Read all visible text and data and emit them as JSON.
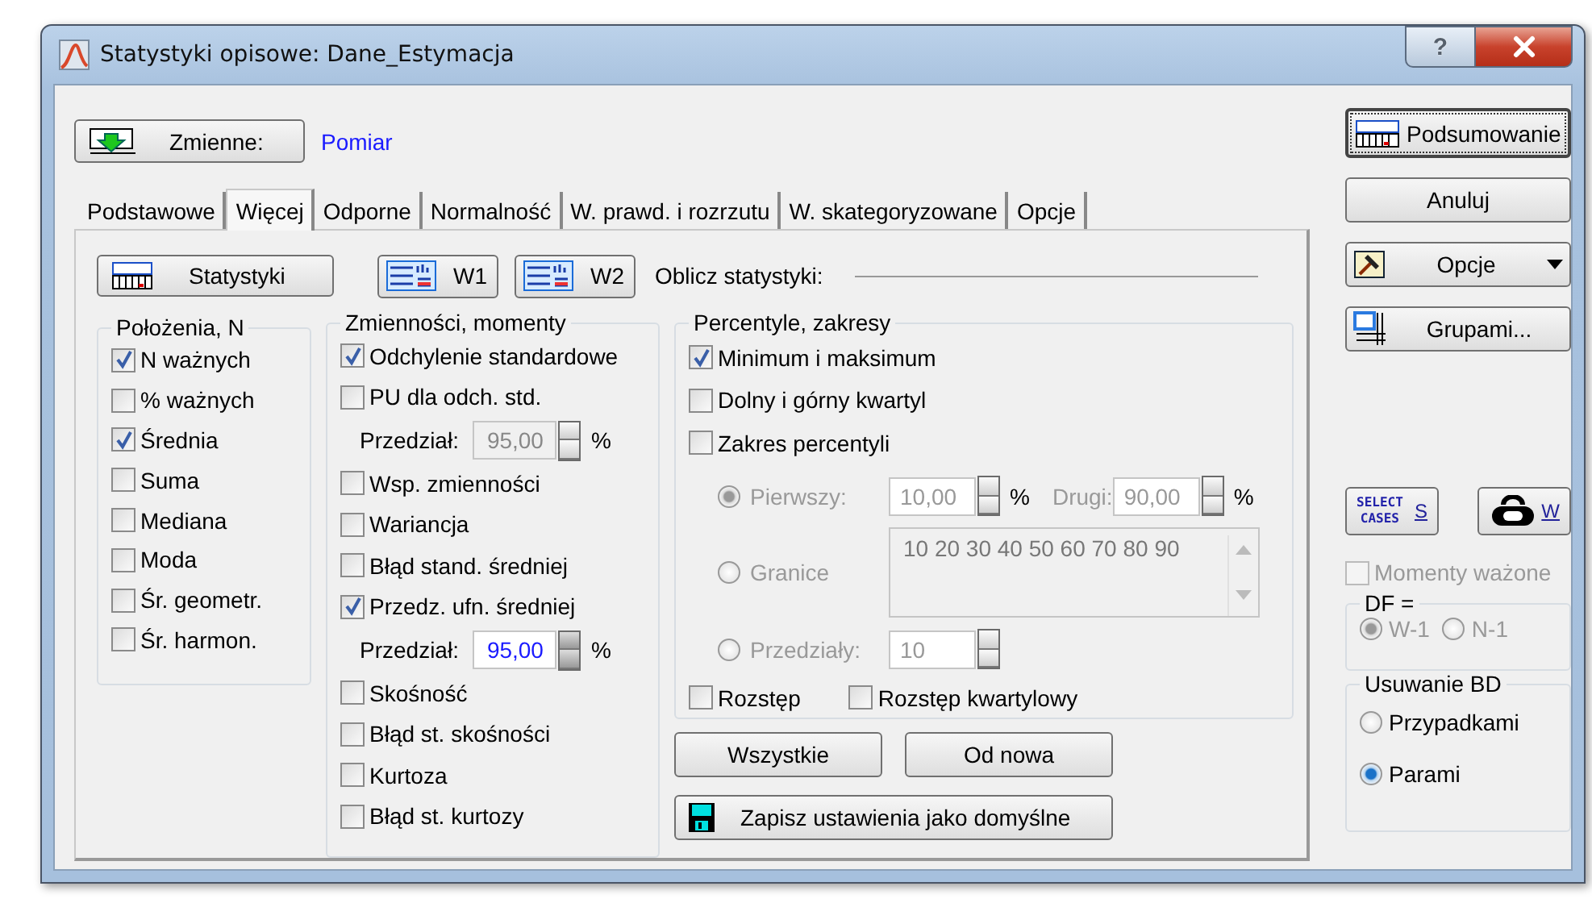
{
  "window": {
    "title": "Statystyki opisowe: Dane_Estymacja",
    "help": "?"
  },
  "variables": {
    "button": "Zmienne:",
    "value": "Pomiar"
  },
  "tabs": [
    {
      "label": "Podstawowe",
      "selected": false
    },
    {
      "label": "Więcej",
      "selected": true
    },
    {
      "label": "Odporne",
      "selected": false
    },
    {
      "label": "Normalność",
      "selected": false
    },
    {
      "label": "W. prawd. i rozrzutu",
      "selected": false
    },
    {
      "label": "W. skategoryzowane",
      "selected": false
    },
    {
      "label": "Opcje",
      "selected": false
    }
  ],
  "toolbar": {
    "stats_button": "Statystyki",
    "w1_button": "W1",
    "w2_button": "W2",
    "compute_label": "Oblicz statystyki:"
  },
  "location_group": {
    "title": "Położenia, N",
    "items": [
      {
        "label": "N ważnych",
        "checked": true
      },
      {
        "label": "% ważnych",
        "checked": false
      },
      {
        "label": "Średnia",
        "checked": true
      },
      {
        "label": "Suma",
        "checked": false
      },
      {
        "label": "Mediana",
        "checked": false
      },
      {
        "label": "Moda",
        "checked": false
      },
      {
        "label": "Śr. geometr.",
        "checked": false
      },
      {
        "label": "Śr. harmon.",
        "checked": false
      }
    ]
  },
  "variability_group": {
    "title": "Zmienności, momenty",
    "items": [
      {
        "kind": "checkbox",
        "label": "Odchylenie standardowe",
        "checked": true
      },
      {
        "kind": "checkbox",
        "label": "PU dla odch. std.",
        "checked": false
      },
      {
        "kind": "spin",
        "label": "Przedział:",
        "value": "95,00",
        "unit": "%",
        "disabled": true
      },
      {
        "kind": "checkbox",
        "label": "Wsp. zmienności",
        "checked": false
      },
      {
        "kind": "checkbox",
        "label": "Wariancja",
        "checked": false
      },
      {
        "kind": "checkbox",
        "label": "Błąd stand. średniej",
        "checked": false
      },
      {
        "kind": "checkbox",
        "label": "Przedz. ufn. średniej",
        "checked": true
      },
      {
        "kind": "spin",
        "label": "Przedział:",
        "value": "95,00",
        "unit": "%",
        "disabled": false
      },
      {
        "kind": "checkbox",
        "label": "Skośność",
        "checked": false
      },
      {
        "kind": "checkbox",
        "label": "Błąd st. skośności",
        "checked": false
      },
      {
        "kind": "checkbox",
        "label": "Kurtoza",
        "checked": false
      },
      {
        "kind": "checkbox",
        "label": "Błąd st. kurtozy",
        "checked": false
      }
    ]
  },
  "percentiles_group": {
    "title": "Percentyle, zakresy",
    "checks": [
      {
        "label": "Minimum i maksimum",
        "checked": true
      },
      {
        "label": "Dolny i górny kwartyl",
        "checked": false
      },
      {
        "label": "Zakres percentyli",
        "checked": false
      }
    ],
    "first": {
      "label": "Pierwszy:",
      "selected": true,
      "value": "10,00",
      "unit": "%",
      "second_label": "Drugi:",
      "second_value": "90,00",
      "second_unit": "%"
    },
    "bounds": {
      "label": "Granice",
      "selected": false,
      "value": "10 20 30 40 50 60 70 80 90"
    },
    "intervals": {
      "label": "Przedziały:",
      "selected": false,
      "value": "10"
    },
    "disabled": true,
    "bottom_checks": [
      {
        "label": "Rozstęp",
        "checked": false
      },
      {
        "label": "Rozstęp kwartylowy",
        "checked": false
      }
    ]
  },
  "panel_buttons": {
    "all": "Wszystkie",
    "reset": "Od nowa",
    "save": "Zapisz ustawienia jako domyślne"
  },
  "side": {
    "summary": "Podsumowanie",
    "cancel": "Anuluj",
    "options": "Opcje",
    "by_group": "Grupami...",
    "select_cases": {
      "icon_lines": [
        "SELECT",
        "CASES"
      ],
      "label": "S"
    },
    "weight": {
      "label": "W"
    },
    "weighted_moments": {
      "label": "Momenty ważone",
      "checked": false,
      "disabled": true
    },
    "df": {
      "title": "DF =",
      "disabled": true,
      "options": [
        {
          "label": "W-1",
          "selected": true
        },
        {
          "label": "N-1",
          "selected": false
        }
      ]
    },
    "missing": {
      "title": "Usuwanie BD",
      "options": [
        {
          "label": "Przypadkami",
          "selected": false
        },
        {
          "label": "Parami",
          "selected": true
        }
      ]
    }
  }
}
